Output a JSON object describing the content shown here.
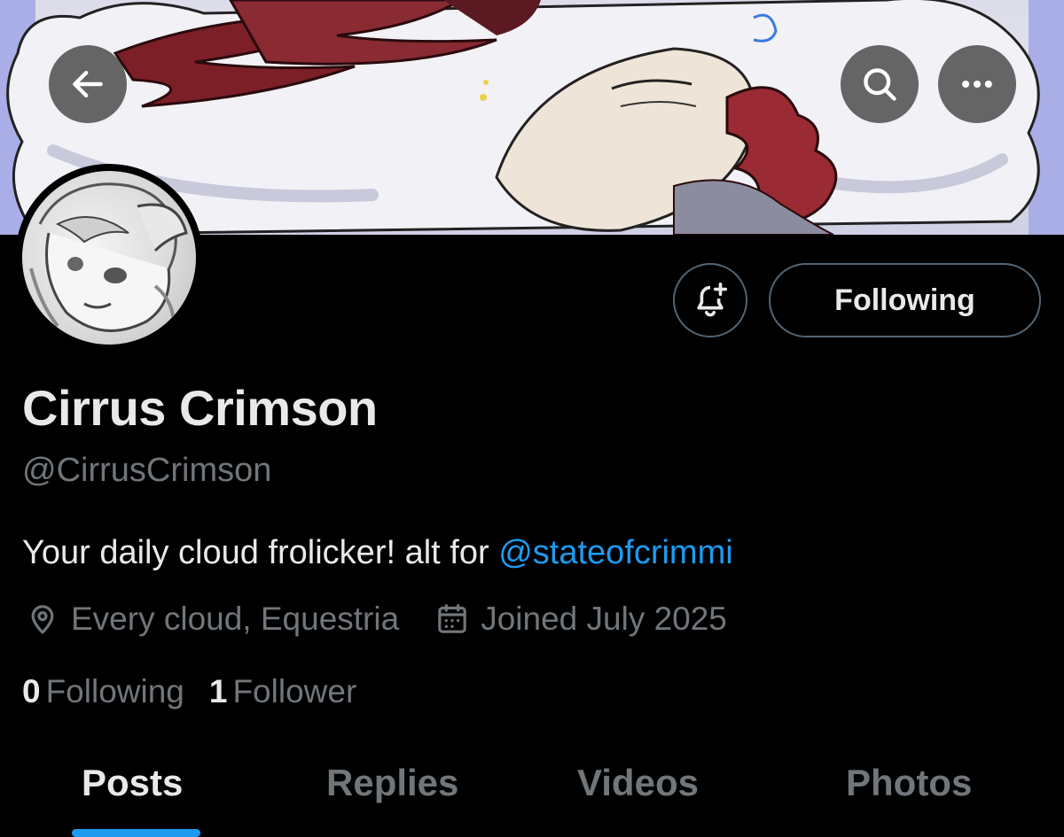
{
  "header": {
    "back_icon": "arrow-left-icon",
    "search_icon": "search-icon",
    "more_icon": "more-horizontal-icon"
  },
  "profile": {
    "display_name": "Cirrus Crimson",
    "handle": "@CirrusCrimson",
    "bio_text": "Your daily cloud frolicker! alt for ",
    "bio_mention": "@stateofcrimmi",
    "location": "Every cloud, Equestria",
    "joined": "Joined July 2025"
  },
  "actions": {
    "notify_icon": "bell-plus-icon",
    "following_label": "Following"
  },
  "stats": {
    "following_count": "0",
    "following_label": "Following",
    "followers_count": "1",
    "followers_label": "Follower"
  },
  "tabs": [
    {
      "label": "Posts",
      "active": true
    },
    {
      "label": "Replies",
      "active": false
    },
    {
      "label": "Videos",
      "active": false
    },
    {
      "label": "Photos",
      "active": false
    }
  ],
  "colors": {
    "background": "#000000",
    "primary_text": "#e7e9ea",
    "secondary_text": "#71767b",
    "accent": "#1d9bf0",
    "border": "#536471"
  }
}
